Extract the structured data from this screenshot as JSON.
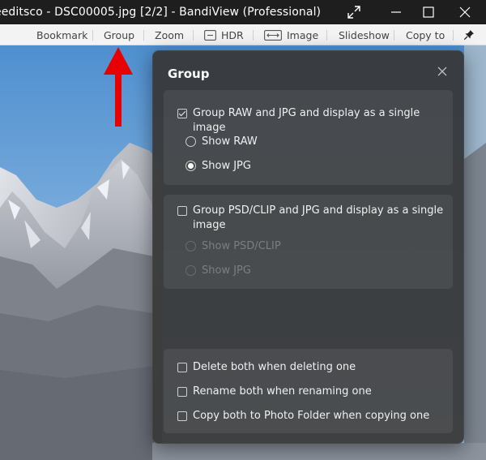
{
  "window": {
    "title": "eeditsco - DSC00005.jpg [2/2] - BandiView (Professional)"
  },
  "toolbar": {
    "items": [
      {
        "label": "Bookmark"
      },
      {
        "label": "Group"
      },
      {
        "label": "Zoom"
      },
      {
        "label": "HDR",
        "icon": "hdr-icon"
      },
      {
        "label": "Image",
        "icon": "image-fit-icon"
      },
      {
        "label": "Slideshow"
      },
      {
        "label": "Copy to"
      }
    ],
    "pin_icon": "pin-icon"
  },
  "dialog": {
    "title": "Group",
    "group_raw": {
      "label": "Group RAW and JPG and display as a single image",
      "checked": true,
      "options": [
        {
          "label": "Show RAW",
          "selected": false
        },
        {
          "label": "Show JPG",
          "selected": true
        }
      ]
    },
    "group_psd": {
      "label_line1": "Group PSD/CLIP and JPG and display as a single",
      "label_line2": "image",
      "checked": false,
      "options": [
        {
          "label": "Show PSD/CLIP",
          "selected": false,
          "disabled": true
        },
        {
          "label": "Show JPG",
          "selected": false,
          "disabled": true
        }
      ]
    },
    "extra_options": [
      {
        "label": "Delete both when deleting one",
        "checked": false
      },
      {
        "label": "Rename both when renaming one",
        "checked": false
      },
      {
        "label": "Copy both to Photo Folder when copying one",
        "checked": false
      }
    ]
  },
  "colors": {
    "titlebar_bg": "#1e1e1e",
    "toolbar_bg": "#f3f3f3",
    "dialog_bg": "#373737",
    "arrow": "#e60000"
  }
}
